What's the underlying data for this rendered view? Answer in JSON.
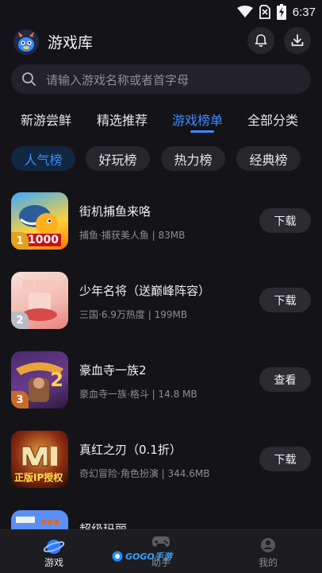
{
  "status_bar": {
    "time": "6:37"
  },
  "header": {
    "title": "游戏库"
  },
  "search": {
    "placeholder": "请输入游戏名称或者首字母"
  },
  "tabs": [
    {
      "label": "新游尝鲜"
    },
    {
      "label": "精选推荐"
    },
    {
      "label": "游戏榜单",
      "active": true
    },
    {
      "label": "全部分类"
    }
  ],
  "chips": [
    {
      "label": "人气榜",
      "active": true
    },
    {
      "label": "好玩榜"
    },
    {
      "label": "热力榜"
    },
    {
      "label": "经典榜"
    }
  ],
  "games": [
    {
      "rank": "1",
      "name": "街机捕鱼来咯",
      "meta": "捕鱼·捕获美人鱼 | 83MB",
      "action": "下载",
      "thumb_text": "1000"
    },
    {
      "rank": "2",
      "name": "少年名将（送巅峰阵容）",
      "meta": "三国·6.9万热度 | 199MB",
      "action": "下载"
    },
    {
      "rank": "3",
      "name": "豪血寺一族2",
      "meta": "豪血寺一族·格斗 | 14.8 MB",
      "action": "查看",
      "thumb_text": "2"
    },
    {
      "rank": "",
      "name": "真红之刃（0.1折）",
      "meta": "奇幻冒险·角色扮演 | 344.6MB",
      "action": "下载",
      "thumb_text": "正版IP授权"
    },
    {
      "rank": "",
      "name": "超级玛丽",
      "meta": "",
      "action": ""
    }
  ],
  "bottom_nav": [
    {
      "label": "游戏",
      "active": true
    },
    {
      "label": "助手",
      "logo_text": "GOGO手游"
    },
    {
      "label": "我的"
    }
  ],
  "colors": {
    "accent": "#3d8bff",
    "background": "#141418"
  }
}
